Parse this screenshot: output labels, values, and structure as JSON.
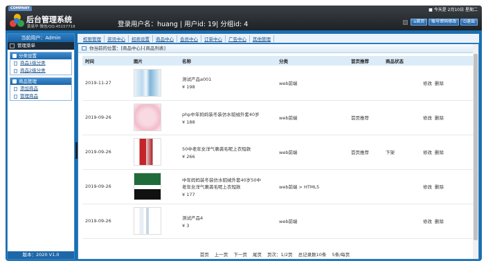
{
  "header": {
    "company_badge": "COMPANY",
    "app_title": "后台管理系统",
    "author": "黄易华 微信/QQ:45157718",
    "login_info": "登录用户名：huang | 用户id: 19| 分组id: 4",
    "date": "今天是 2月10日 星期二",
    "buttons": {
      "home": "首页",
      "change_password": "账号密码修改",
      "logout": "退出"
    }
  },
  "sidebar": {
    "current_user": "当前用户：Admin",
    "menu_title": "管理菜单",
    "groups": [
      {
        "title": "分类设置",
        "items": [
          "商品1级分类",
          "商品2级分类"
        ]
      },
      {
        "title": "商品管理",
        "items": [
          "添加商品",
          "管理商品"
        ]
      }
    ],
    "version": "版本：2020 V1.0"
  },
  "topnav": [
    "权限管理",
    "资讯中心",
    "招商设置",
    "商品中心",
    "会员中心",
    "订单中心",
    "广告中心",
    "其他管理"
  ],
  "breadcrumb": "你当前的位置：[商品中心]-[商品列表]",
  "table": {
    "headers": [
      "时间",
      "图片",
      "名称",
      "分类",
      "首页推荐",
      "商品状态",
      ""
    ],
    "rows": [
      {
        "time": "2019-11-27",
        "name1": "测试产品a001",
        "name2": "",
        "price": "¥ 198",
        "category": "web前端",
        "recommend": "",
        "status": "",
        "edit": "修改",
        "delete": "删除"
      },
      {
        "time": "2019-09-26",
        "name1": "php中年妈妈装冬装仿水貂绒外套40岁",
        "name2": "",
        "price": "¥ 188",
        "category": "web前端",
        "recommend": "首页推荐",
        "status": "",
        "edit": "修改",
        "delete": "删除"
      },
      {
        "time": "2019-09-26",
        "name1": "50中老年女洋气裹袭毛呢上衣短款",
        "name2": "",
        "price": "¥ 266",
        "category": "web前端",
        "recommend": "首页推荐",
        "status": "下架",
        "edit": "修改",
        "delete": "删除"
      },
      {
        "time": "2019-09-26",
        "name1": "中年妈妈装冬装仿水貂绒外套40岁50中",
        "name2": "老年女洋气裹袭毛呢上衣短款",
        "price": "¥ 177",
        "category": "web前端 > HTML5",
        "recommend": "",
        "status": "",
        "edit": "修改",
        "delete": "删除"
      },
      {
        "time": "2019-09-26",
        "name1": "测试产品4",
        "name2": "",
        "price": "¥ 3",
        "category": "web前端",
        "recommend": "",
        "status": "",
        "edit": "修改",
        "delete": "删除"
      }
    ]
  },
  "pager": {
    "first": "首页",
    "prev": "上一页",
    "next": "下一页",
    "last": "尾页",
    "page_info": "页次：1/2页",
    "total": "总记录数10条",
    "per_page": "5条/每页"
  }
}
